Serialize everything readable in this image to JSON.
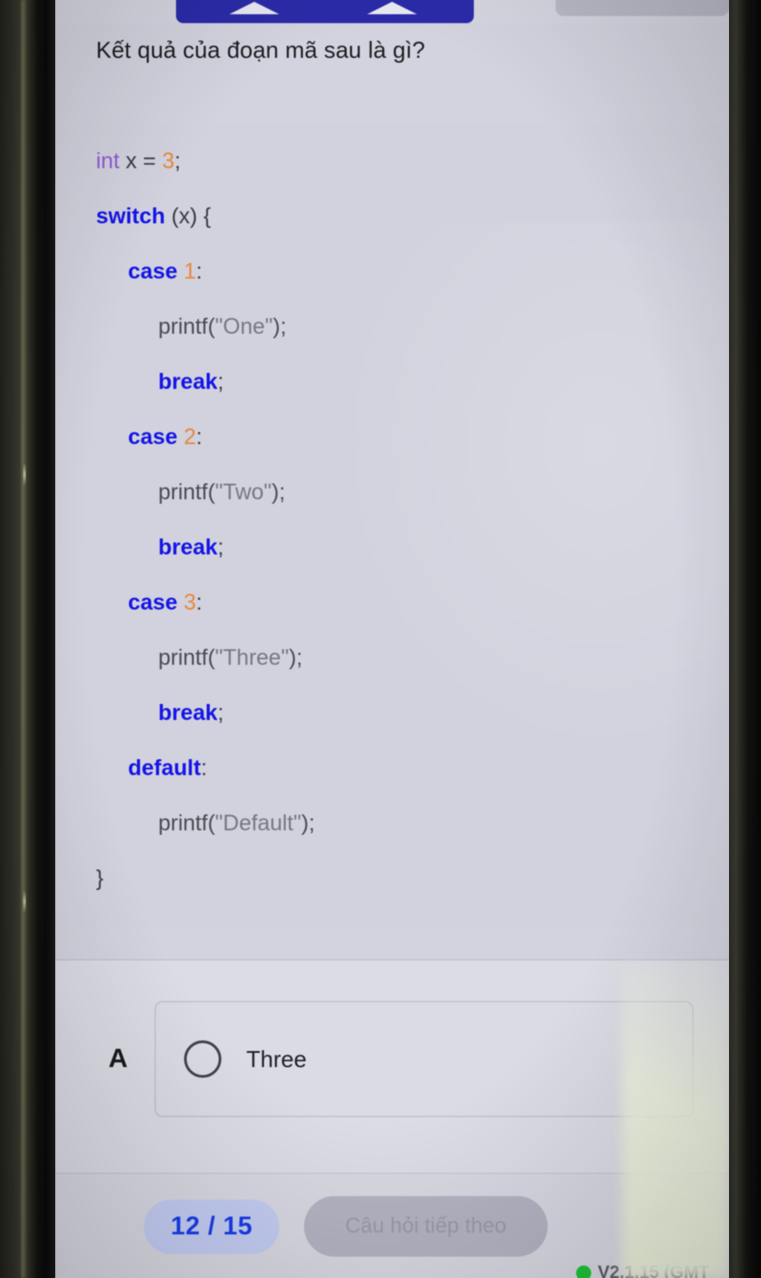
{
  "app": {
    "background_color": "#d3d3df",
    "accent_color": "#1a3ce8",
    "topbar_button_color": "#2b2ba8"
  },
  "question": {
    "text": "Kết quả của đoạn mã sau là gì?"
  },
  "code": {
    "language": "c",
    "lines": [
      {
        "indent": 0,
        "tokens": [
          {
            "t": "int ",
            "c": "kw-type"
          },
          {
            "t": "x = ",
            "c": "punc"
          },
          {
            "t": "3",
            "c": "num"
          },
          {
            "t": ";",
            "c": "punc"
          }
        ]
      },
      {
        "indent": 0,
        "tokens": [
          {
            "t": "switch",
            "c": "kw"
          },
          {
            "t": " (x) {",
            "c": "punc"
          }
        ]
      },
      {
        "indent": 1,
        "tokens": [
          {
            "t": "case ",
            "c": "kw"
          },
          {
            "t": "1",
            "c": "num"
          },
          {
            "t": ":",
            "c": "punc"
          }
        ]
      },
      {
        "indent": 2,
        "tokens": [
          {
            "t": "printf(",
            "c": "fn"
          },
          {
            "t": "\"One\"",
            "c": "str"
          },
          {
            "t": ");",
            "c": "fn"
          }
        ]
      },
      {
        "indent": 2,
        "tokens": [
          {
            "t": "break",
            "c": "kw"
          },
          {
            "t": ";",
            "c": "punc"
          }
        ]
      },
      {
        "indent": 1,
        "tokens": [
          {
            "t": "case ",
            "c": "kw"
          },
          {
            "t": "2",
            "c": "num"
          },
          {
            "t": ":",
            "c": "punc"
          }
        ]
      },
      {
        "indent": 2,
        "tokens": [
          {
            "t": "printf(",
            "c": "fn"
          },
          {
            "t": "\"Two\"",
            "c": "str"
          },
          {
            "t": ");",
            "c": "fn"
          }
        ]
      },
      {
        "indent": 2,
        "tokens": [
          {
            "t": "break",
            "c": "kw"
          },
          {
            "t": ";",
            "c": "punc"
          }
        ]
      },
      {
        "indent": 1,
        "tokens": [
          {
            "t": "case ",
            "c": "kw"
          },
          {
            "t": "3",
            "c": "num"
          },
          {
            "t": ":",
            "c": "punc"
          }
        ]
      },
      {
        "indent": 2,
        "tokens": [
          {
            "t": "printf(",
            "c": "fn"
          },
          {
            "t": "\"Three\"",
            "c": "str"
          },
          {
            "t": ");",
            "c": "fn"
          }
        ]
      },
      {
        "indent": 2,
        "tokens": [
          {
            "t": "break",
            "c": "kw"
          },
          {
            "t": ";",
            "c": "punc"
          }
        ]
      },
      {
        "indent": 1,
        "tokens": [
          {
            "t": "default",
            "c": "kw"
          },
          {
            "t": ":",
            "c": "punc"
          }
        ]
      },
      {
        "indent": 2,
        "tokens": [
          {
            "t": "printf(",
            "c": "fn"
          },
          {
            "t": "\"Default\"",
            "c": "str"
          },
          {
            "t": ");",
            "c": "fn"
          }
        ]
      },
      {
        "indent": 0,
        "tokens": [
          {
            "t": "}",
            "c": "punc"
          }
        ]
      }
    ]
  },
  "answers": [
    {
      "letter": "A",
      "label": "Three",
      "selected": false
    }
  ],
  "bottom_bar": {
    "progress_label": "12 / 15",
    "current": 12,
    "total": 15,
    "next_button_label": "Câu hỏi tiếp theo",
    "next_button_enabled": false,
    "version_label": "V2.1.15 (GMT",
    "status_dot_color": "#1fc23a"
  }
}
